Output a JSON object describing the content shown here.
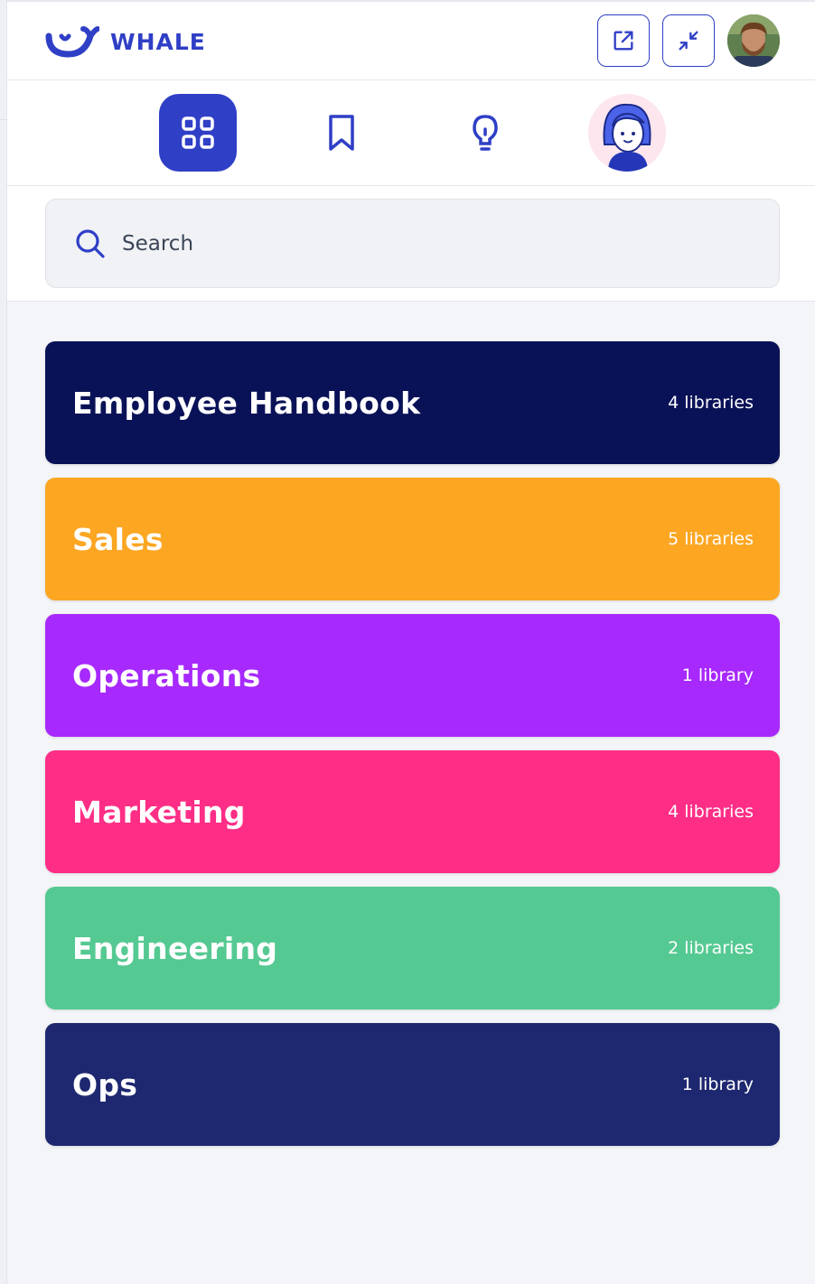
{
  "app": {
    "name": "WHALE",
    "brand_color": "#2f3fc6"
  },
  "header": {
    "buttons": [
      {
        "icon": "external-link-icon"
      },
      {
        "icon": "minimize-icon"
      }
    ],
    "avatar": "user-avatar"
  },
  "nav": {
    "items": [
      {
        "icon": "grid-icon",
        "active": true
      },
      {
        "icon": "bookmark-icon",
        "active": false
      },
      {
        "icon": "lightbulb-icon",
        "active": false
      },
      {
        "icon": "assistant-avatar",
        "active": false
      }
    ]
  },
  "search": {
    "placeholder": "Search",
    "value": ""
  },
  "categories": [
    {
      "title": "Employee Handbook",
      "count": "4 libraries",
      "color": "#0a1257"
    },
    {
      "title": "Sales",
      "count": "5 libraries",
      "color": "#fca622"
    },
    {
      "title": "Operations",
      "count": "1 library",
      "color": "#a729fd"
    },
    {
      "title": "Marketing",
      "count": "4 libraries",
      "color": "#fe2e86"
    },
    {
      "title": "Engineering",
      "count": "2 libraries",
      "color": "#55c992"
    },
    {
      "title": "Ops",
      "count": "1 library",
      "color": "#1e2870"
    }
  ]
}
